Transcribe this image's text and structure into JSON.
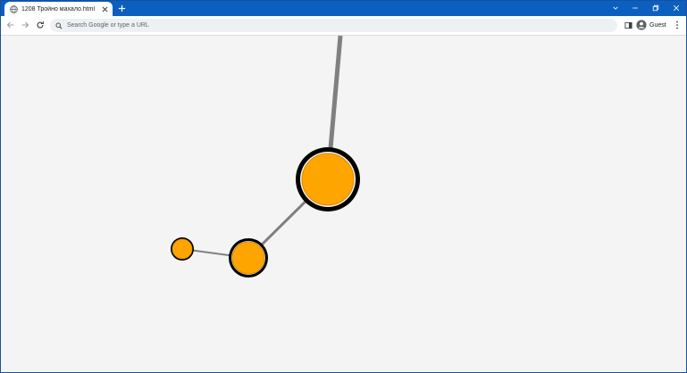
{
  "browser": {
    "tab_title": "1208 Тройно махало.html",
    "omnibox_placeholder": "Search Google or type a URL",
    "profile_label": "Guest",
    "accent_color": "#0b5fbf",
    "icons": {
      "favicon": "globe-icon",
      "tab_close": "close-icon",
      "new_tab": "plus-icon",
      "tab_search": "chevron-down-icon",
      "minimize": "minimize-icon",
      "restore": "restore-icon",
      "close_window": "close-icon",
      "back": "arrow-left-icon",
      "forward": "arrow-right-icon",
      "reload": "reload-icon",
      "search": "search-icon",
      "side_panel": "side-panel-icon",
      "profile": "person-icon",
      "menu": "kebab-menu-icon"
    }
  },
  "scene": {
    "background_color": "#f4f4f4",
    "bob_color": "#ffa500",
    "outline_color": "#000000",
    "rod_color": "#808080"
  }
}
